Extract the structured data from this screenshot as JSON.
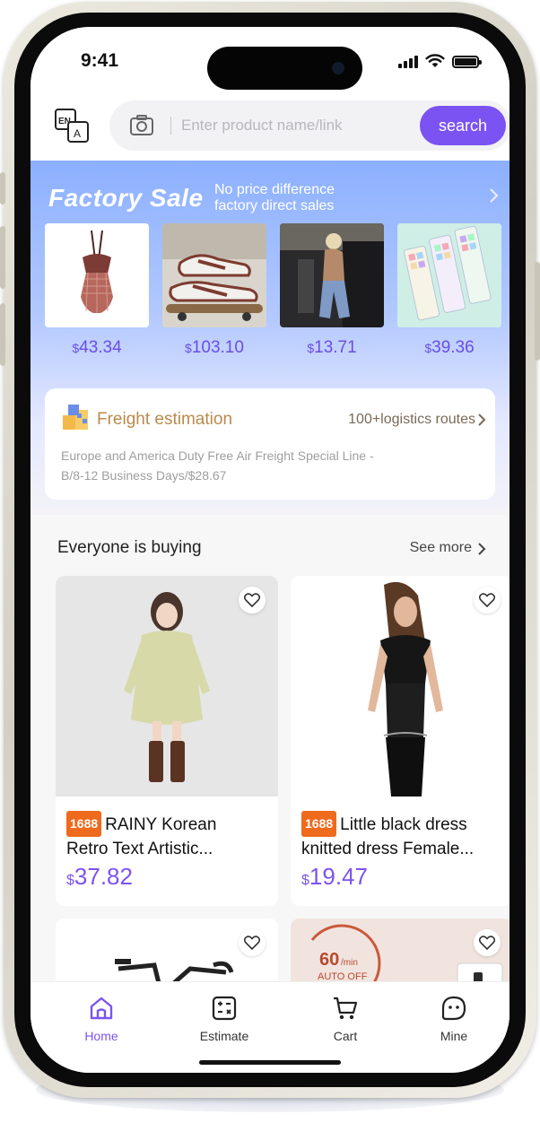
{
  "status_bar": {
    "time": "9:41"
  },
  "header": {
    "lang_icon": "language-translate-icon",
    "search_placeholder": "Enter product name/link",
    "search_button": "search",
    "accent_color": "#7b53f2"
  },
  "factory_sale": {
    "title": "Factory Sale",
    "subtitle_line1": "No price difference",
    "subtitle_line2": "factory direct sales",
    "products": [
      {
        "currency": "$",
        "price": "43.34",
        "image": "swimsuit"
      },
      {
        "currency": "$",
        "price": "103.10",
        "image": "sneakers"
      },
      {
        "currency": "$",
        "price": "13.71",
        "image": "woman-in-car"
      },
      {
        "currency": "$",
        "price": "39.36",
        "image": "keyboard"
      }
    ]
  },
  "freight": {
    "title": "Freight estimation",
    "routes": "100+logistics routes",
    "description_line1": "Europe and America Duty Free Air Freight Special Line -",
    "description_line2": "B/8-12 Business Days/$28.67"
  },
  "everyone_buying": {
    "title": "Everyone is buying",
    "see_more": "See more",
    "items": [
      {
        "badge": "1688",
        "title_line1": "RAINY Korean",
        "title_line2": "Retro Text Artistic...",
        "currency": "$",
        "price": "37.82"
      },
      {
        "badge": "1688",
        "title_line1": "Little black dress",
        "title_line2": "knitted dress Female...",
        "currency": "$",
        "price": "19.47"
      },
      {
        "image": "bicycle"
      },
      {
        "image_text_number": "60",
        "image_text_unit": "/min",
        "image_text_label": "AUTO OFF"
      }
    ]
  },
  "tabbar": {
    "tabs": [
      {
        "label": "Home",
        "icon": "home-icon",
        "active": true
      },
      {
        "label": "Estimate",
        "icon": "calculator-icon",
        "active": false
      },
      {
        "label": "Cart",
        "icon": "cart-icon",
        "active": false
      },
      {
        "label": "Mine",
        "icon": "profile-icon",
        "active": false
      }
    ]
  }
}
